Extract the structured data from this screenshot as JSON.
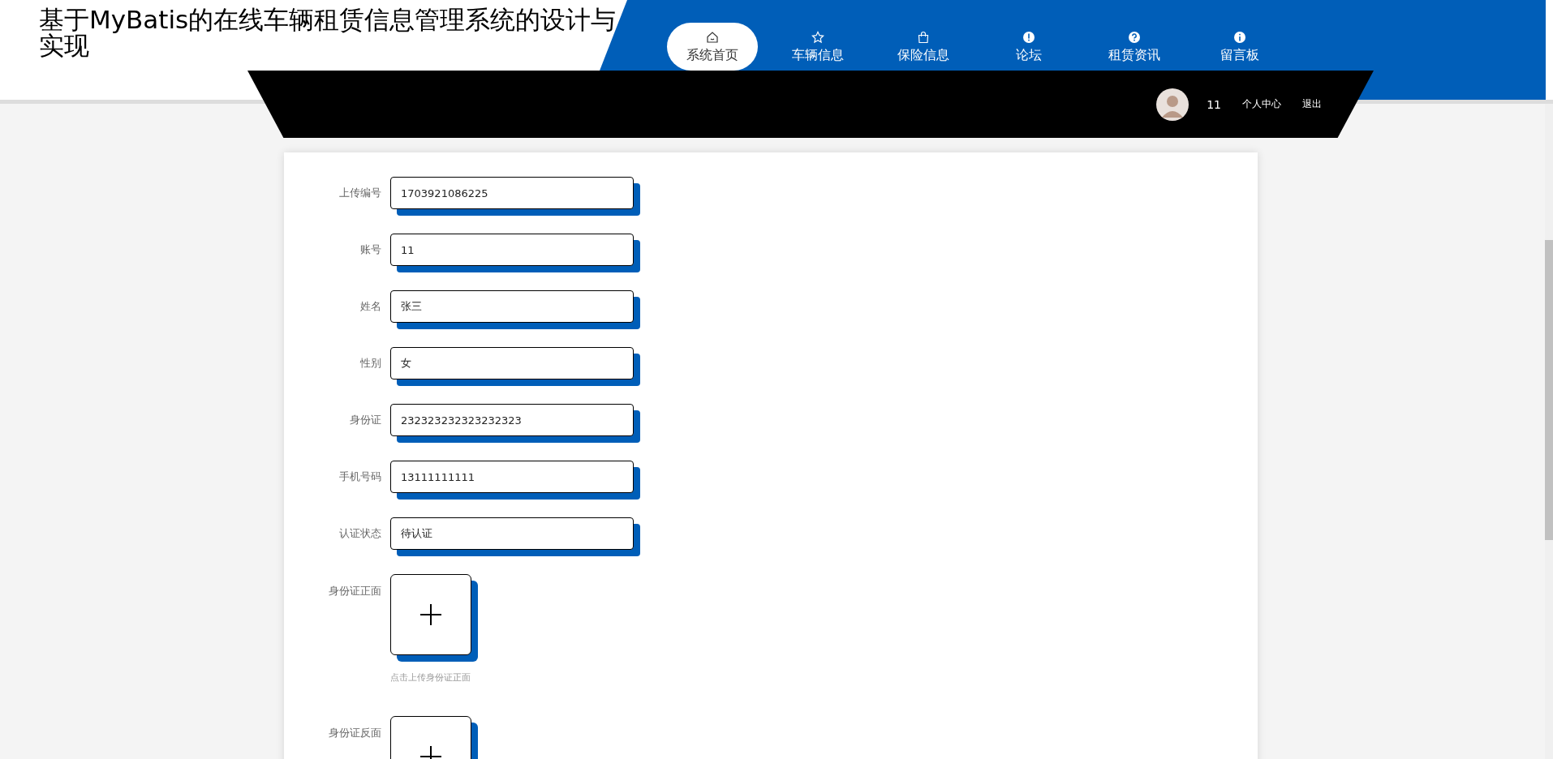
{
  "header": {
    "title": "基于MyBatis的在线车辆租赁信息管理系统的设计与实现"
  },
  "nav": [
    {
      "label": "系统首页",
      "selected": true
    },
    {
      "label": "车辆信息",
      "selected": false
    },
    {
      "label": "保险信息",
      "selected": false
    },
    {
      "label": "论坛",
      "selected": false
    },
    {
      "label": "租赁资讯",
      "selected": false
    },
    {
      "label": "留言板",
      "selected": false
    }
  ],
  "user_bar": {
    "username": "11",
    "links": [
      "个人中心",
      "退出"
    ]
  },
  "form": {
    "fields": [
      {
        "label": "上传编号",
        "value": "1703921086225"
      },
      {
        "label": "账号",
        "value": "11"
      },
      {
        "label": "姓名",
        "value": "张三"
      },
      {
        "label": "性别",
        "value": "女"
      },
      {
        "label": "身份证",
        "value": "232323232323232323"
      },
      {
        "label": "手机号码",
        "value": "13111111111"
      },
      {
        "label": "认证状态",
        "value": "待认证"
      }
    ],
    "uploads": [
      {
        "label": "身份证正面",
        "hint": "点击上传身份证正面"
      },
      {
        "label": "身份证反面"
      }
    ]
  }
}
